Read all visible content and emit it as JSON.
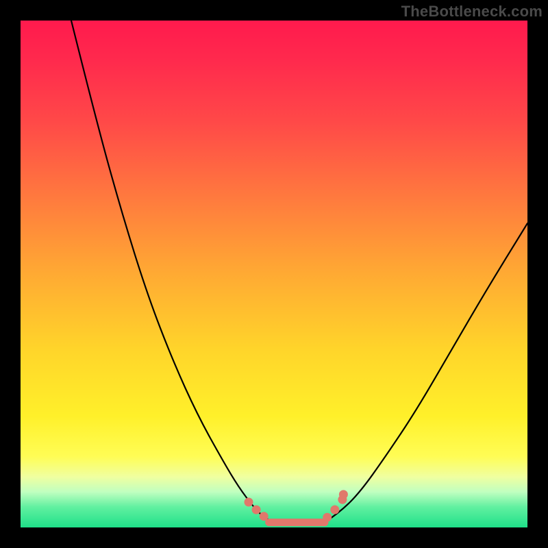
{
  "watermark": "TheBottleneck.com",
  "colors": {
    "page_bg": "#000000",
    "marker": "#e0786b",
    "curve": "#000000",
    "gradient_top": "#ff1a4d",
    "gradient_bottom": "#1fe089"
  },
  "chart_data": {
    "type": "line",
    "title": "",
    "xlabel": "",
    "ylabel": "",
    "xlim": [
      0,
      100
    ],
    "ylim": [
      0,
      100
    ],
    "grid": false,
    "legend": false,
    "series": [
      {
        "name": "left-branch",
        "x": [
          10,
          15,
          20,
          25,
          30,
          35,
          40,
          43,
          46,
          48,
          50
        ],
        "y": [
          100,
          80,
          62,
          46,
          33,
          22,
          13,
          8,
          4,
          2,
          1
        ]
      },
      {
        "name": "flat-minimum",
        "x": [
          50,
          52,
          54,
          56,
          58,
          60
        ],
        "y": [
          1,
          1,
          1,
          1,
          1,
          1
        ]
      },
      {
        "name": "right-branch",
        "x": [
          60,
          63,
          67,
          72,
          78,
          85,
          92,
          100
        ],
        "y": [
          1,
          3,
          7,
          14,
          23,
          35,
          47,
          60
        ]
      }
    ],
    "markers": {
      "name": "highlight-dots",
      "x": [
        45.0,
        46.5,
        48.0,
        60.5,
        62.0,
        63.5,
        63.7
      ],
      "y": [
        5.0,
        3.5,
        2.2,
        2.0,
        3.5,
        5.5,
        6.5
      ]
    },
    "flat_band": {
      "x": [
        49,
        60
      ],
      "y": [
        1.0,
        1.0
      ]
    }
  }
}
